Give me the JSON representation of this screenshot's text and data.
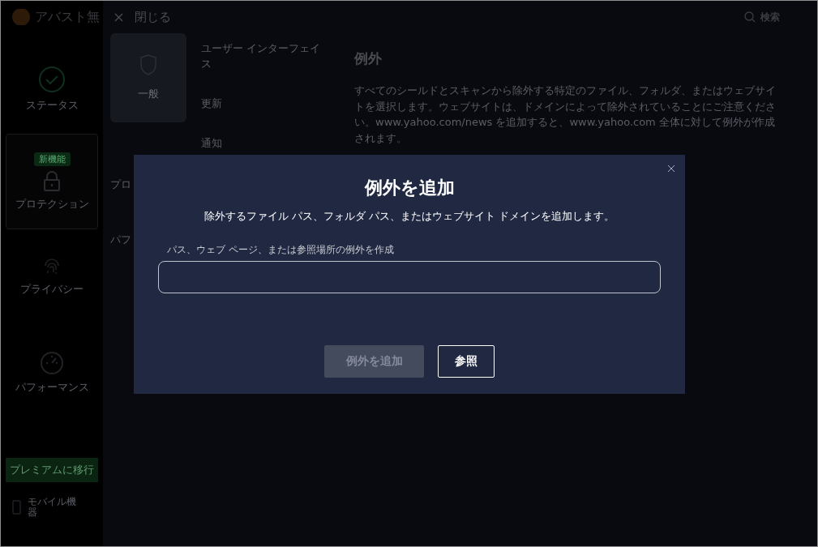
{
  "app_title": "アバスト無",
  "sidebar": {
    "items": [
      {
        "label": "ステータス",
        "selected": false
      },
      {
        "label": "プロテクション",
        "selected": true,
        "badge": "新機能"
      },
      {
        "label": "プライバシー",
        "selected": false
      },
      {
        "label": "パフォーマンス",
        "selected": false
      }
    ],
    "upgrade_button": "プレミアムに移行",
    "mobile_link": "モバイル機器"
  },
  "top_bar": {
    "close_label": "閉じる",
    "search_label": "検索"
  },
  "categories": [
    {
      "label": "一般",
      "selected": true
    },
    {
      "label": "プロ",
      "selected": false
    },
    {
      "label": "パフ",
      "selected": false
    }
  ],
  "subnav": [
    {
      "label": "ユーザー インターフェイス"
    },
    {
      "label": "更新"
    },
    {
      "label": "通知"
    }
  ],
  "section": {
    "title": "例外",
    "description": "すべてのシールドとスキャンから除外する特定のファイル、フォルダ、またはウェブサイトを選択します。ウェブサイトは、ドメインによって除外されていることにご注意ください。www.yahoo.com/news を追加すると、www.yahoo.com 全体に対して例外が作成されます。"
  },
  "dialog": {
    "title": "例外を追加",
    "subtitle": "除外するファイル パス、フォルダ パス、またはウェブサイト ドメインを追加します。",
    "field_label": "パス、ウェブ ページ、または参照場所の例外を作成",
    "buttons": [
      {
        "label": "例外を追加",
        "disabled": true
      },
      {
        "label": "参照",
        "disabled": false
      }
    ]
  }
}
